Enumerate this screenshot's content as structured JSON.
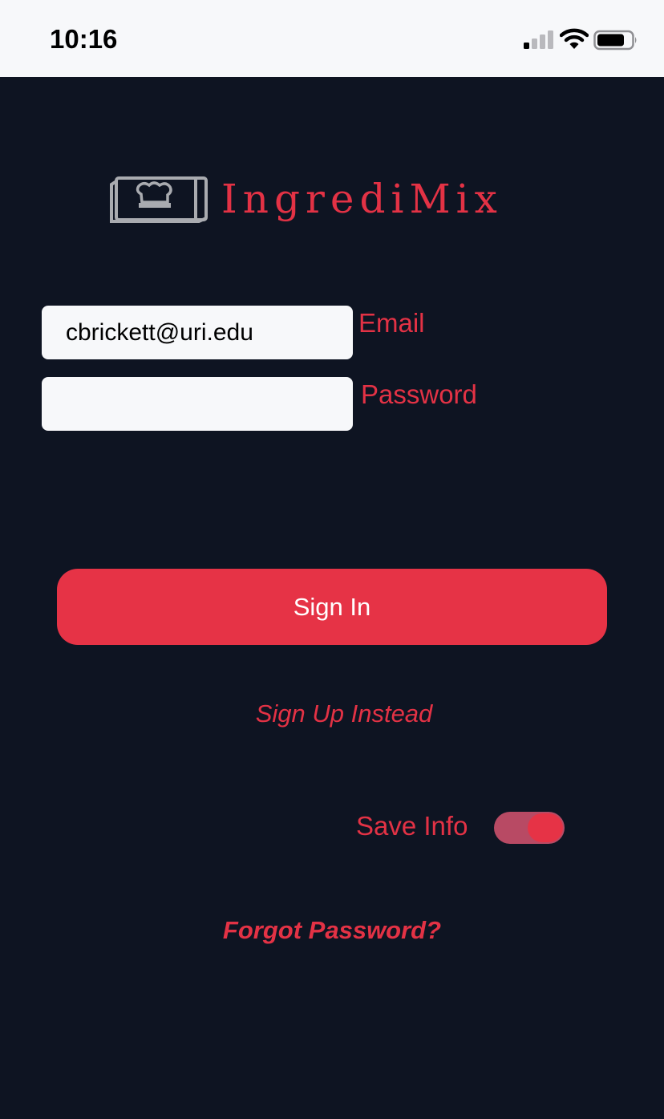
{
  "status_bar": {
    "time": "10:16",
    "signal_icon": "cellular-signal-icon",
    "wifi_icon": "wifi-icon",
    "battery_icon": "battery-icon",
    "battery_level": 0.8
  },
  "logo": {
    "icon": "chef-hat-book-icon",
    "text": "IngrediMix"
  },
  "form": {
    "email_value": "cbrickett@uri.edu",
    "email_label": "Email",
    "password_value": "",
    "password_label": "Password"
  },
  "actions": {
    "sign_in_label": "Sign In",
    "sign_up_label": "Sign Up Instead",
    "save_info_label": "Save Info",
    "save_info_enabled": true,
    "forgot_password_label": "Forgot Password?"
  },
  "colors": {
    "background": "#0e1422",
    "accent": "#e63346",
    "field_background": "#f7f8fa"
  }
}
